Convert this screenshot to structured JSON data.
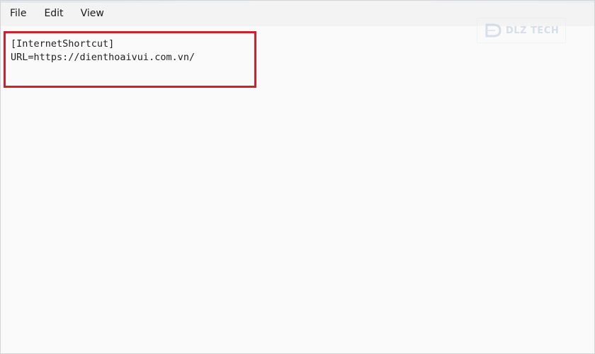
{
  "menu": {
    "file": "File",
    "edit": "Edit",
    "view": "View"
  },
  "editor": {
    "line1": "[InternetShortcut]",
    "line2": "URL=https://dienthoaivui.com.vn/"
  },
  "watermark": {
    "text": "DLZ TECH",
    "logo_icon": "dlz-logo-icon"
  },
  "colors": {
    "highlight": "#d0202b",
    "background": "#fafafa",
    "menubar": "#f3f3f3"
  }
}
